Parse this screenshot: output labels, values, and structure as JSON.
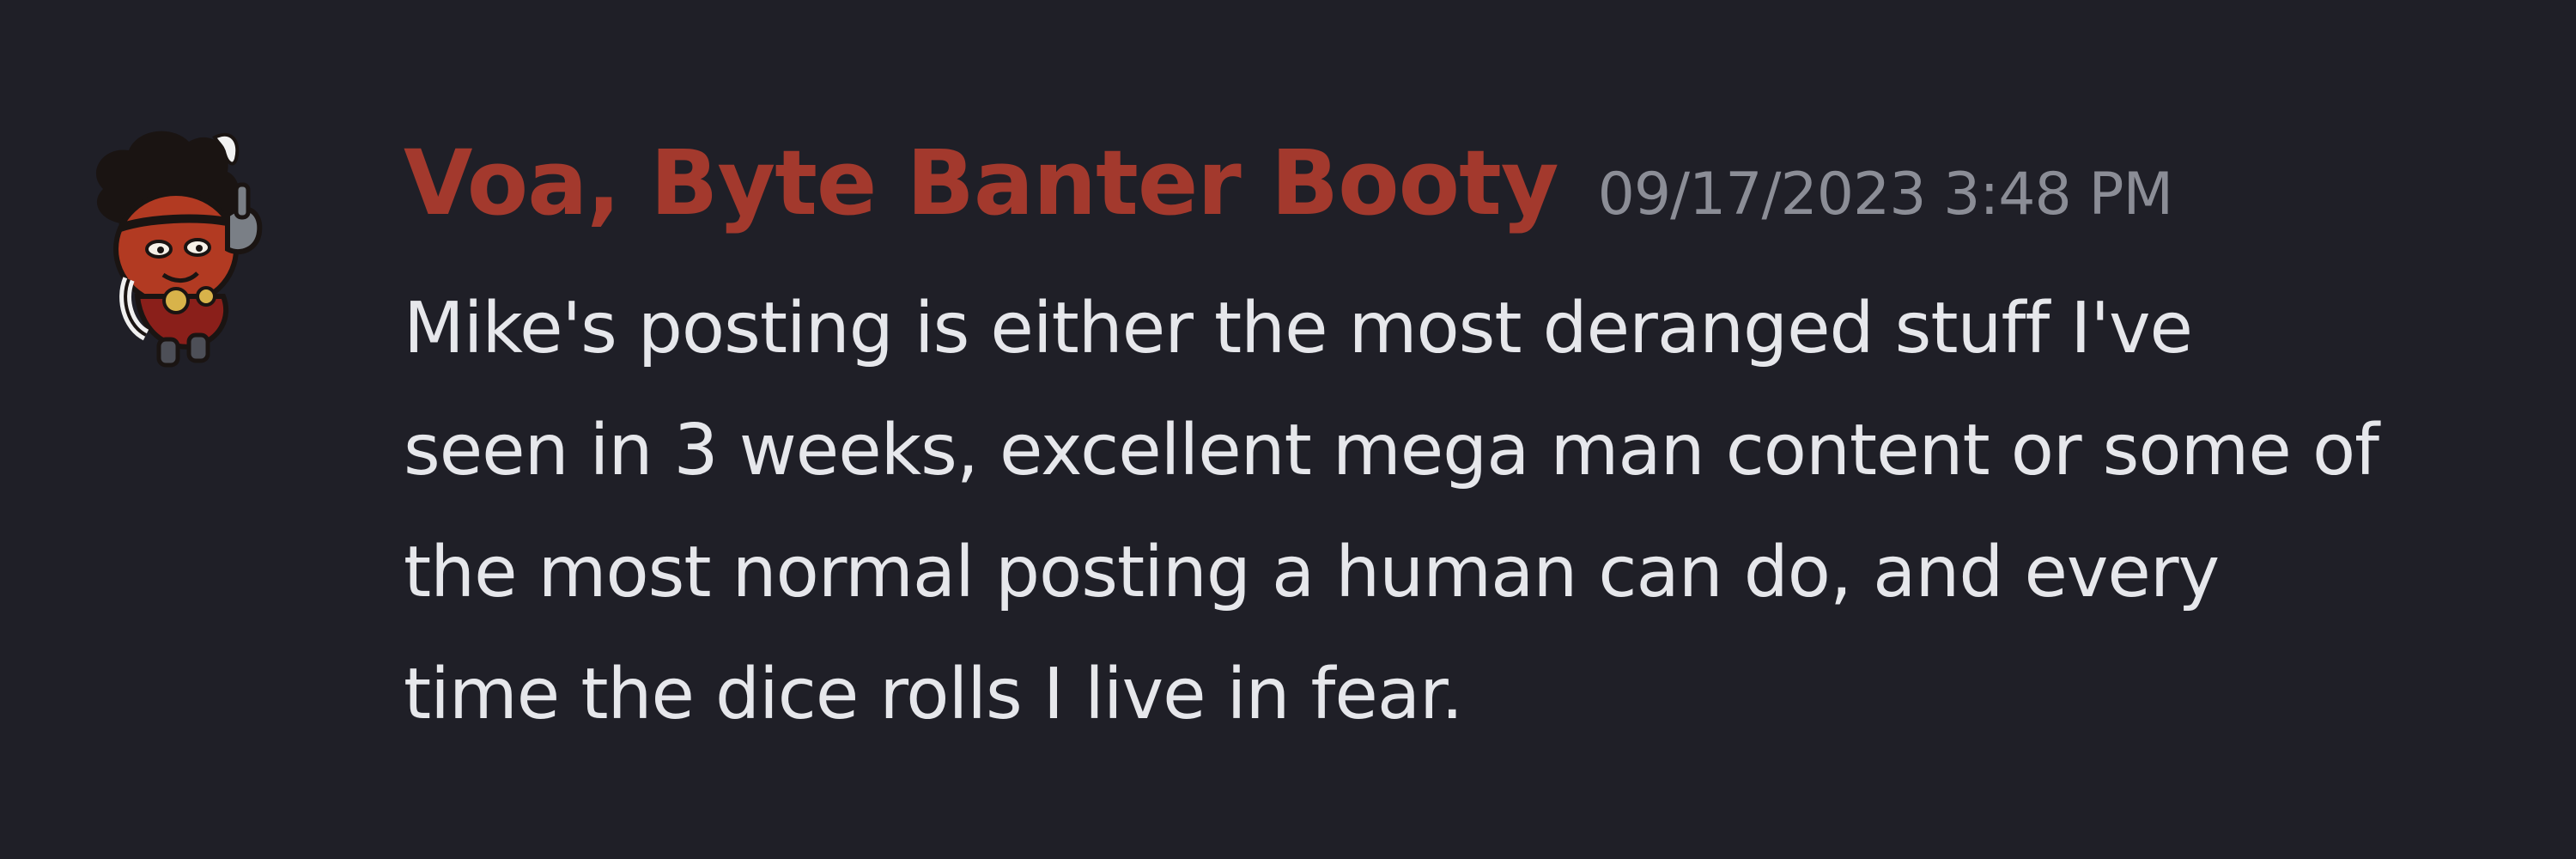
{
  "message": {
    "username": "Voa, Byte Banter Booty",
    "timestamp": "09/17/2023 3:48 PM",
    "lines": [
      "Mike's posting is either the most deranged stuff I've",
      "seen in 3 weeks, excellent mega man content or some of",
      "the most normal posting a human can do, and every",
      "time the dice rolls I live in fear."
    ],
    "avatar_icon": "cartoon-character-avatar"
  },
  "colors": {
    "background": "#1f1f27",
    "username": "#a3392d",
    "timestamp": "#8b8d96",
    "text": "#e6e7eb"
  }
}
